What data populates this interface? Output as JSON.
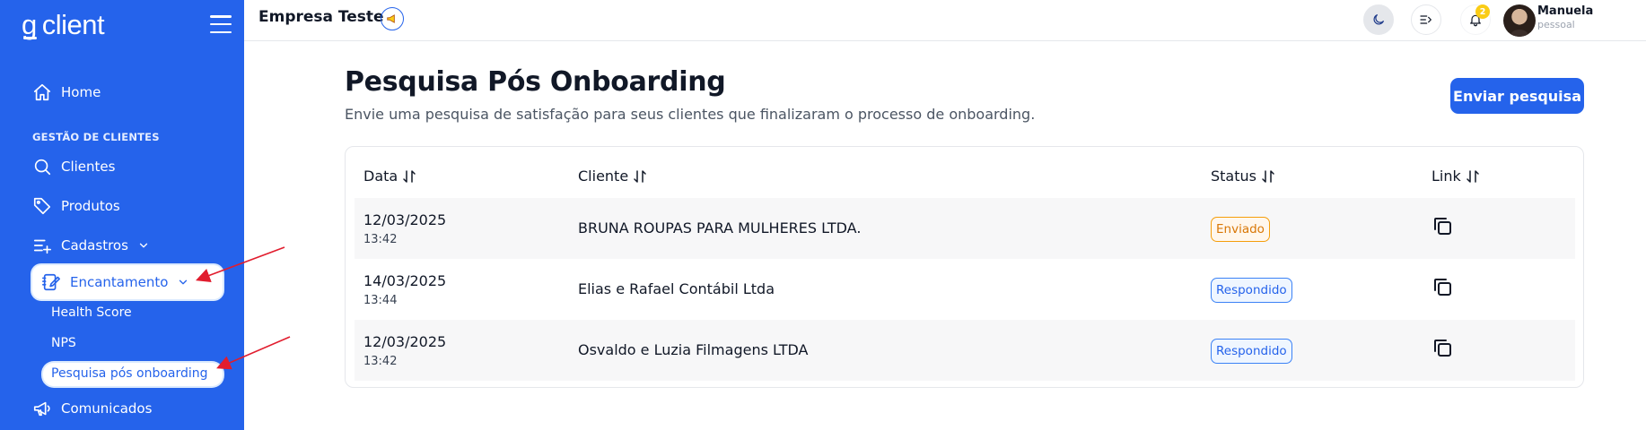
{
  "brand": {
    "logo_g": "g",
    "logo_text": "client"
  },
  "sidebar": {
    "home": "Home",
    "section_title": "GESTÃO DE CLIENTES",
    "items": [
      {
        "label": "Clientes",
        "icon": "search-icon"
      },
      {
        "label": "Produtos",
        "icon": "tag-icon"
      },
      {
        "label": "Cadastros",
        "icon": "list-add-icon"
      },
      {
        "label": "Encantamento",
        "icon": "notebook-edit-icon"
      },
      {
        "label": "Comunicados",
        "icon": "megaphone-icon"
      }
    ],
    "sub_items": [
      "Health Score",
      "NPS",
      "Pesquisa pós onboarding"
    ]
  },
  "topbar": {
    "company": "Empresa Teste",
    "notification_count": "2",
    "user_name": "Manuela",
    "user_role": "pessoal"
  },
  "main": {
    "title": "Pesquisa Pós Onboarding",
    "subtitle": "Envie uma pesquisa de satisfação para seus clientes que finalizaram o processo de onboarding.",
    "send_button": "Enviar pesquisa"
  },
  "table": {
    "headers": [
      "Data",
      "Cliente",
      "Status",
      "Link"
    ],
    "rows": [
      {
        "date": "12/03/2025",
        "time": "13:42",
        "client": "BRUNA ROUPAS PARA MULHERES LTDA.",
        "status": "Enviado"
      },
      {
        "date": "14/03/2025",
        "time": "13:44",
        "client": "Elias e Rafael Contábil Ltda",
        "status": "Respondido"
      },
      {
        "date": "12/03/2025",
        "time": "13:42",
        "client": "Osvaldo e Luzia Filmagens LTDA",
        "status": "Respondido"
      }
    ]
  },
  "colors": {
    "primary": "#2563eb",
    "status_sent": "#d97706",
    "status_answered": "#2563eb",
    "annotation_arrow": "#e11d2e"
  }
}
